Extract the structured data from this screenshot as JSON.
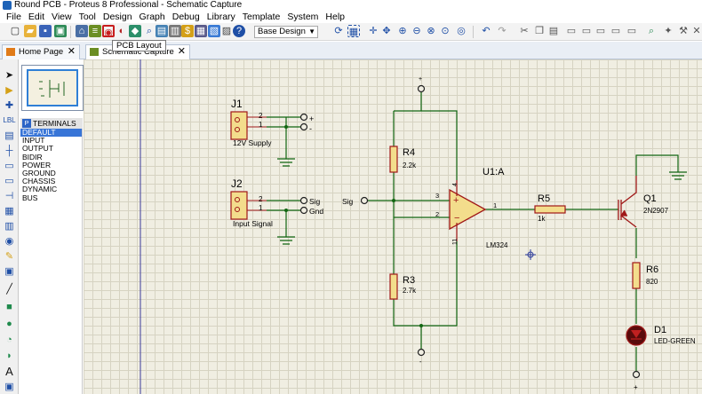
{
  "window": {
    "title": "Round PCB - Proteus 8 Professional - Schematic Capture"
  },
  "menu": [
    "File",
    "Edit",
    "View",
    "Tool",
    "Design",
    "Graph",
    "Debug",
    "Library",
    "Template",
    "System",
    "Help"
  ],
  "toolbar": {
    "design_select": "Base Design",
    "tooltip": "PCB Layout"
  },
  "tabs": [
    {
      "label": "Home Page"
    },
    {
      "label": "Schematic Capture"
    }
  ],
  "terminals": {
    "header": "TERMINALS",
    "button": "P",
    "items": [
      "DEFAULT",
      "INPUT",
      "OUTPUT",
      "BIDIR",
      "POWER",
      "GROUND",
      "CHASSIS",
      "DYNAMIC",
      "BUS"
    ],
    "selected": "DEFAULT"
  },
  "schematic": {
    "j1": {
      "ref": "J1",
      "value": "12V Supply",
      "pin2": "2",
      "pin1": "1",
      "plus": "+",
      "minus": "-"
    },
    "j2": {
      "ref": "J2",
      "value": "Input Signal",
      "pin2": "2",
      "pin1": "1",
      "sig": "Sig",
      "gnd": "Gnd"
    },
    "sig_input": "Sig",
    "r4": {
      "ref": "R4",
      "value": "2.2k"
    },
    "r3": {
      "ref": "R3",
      "value": "2.7k"
    },
    "u1": {
      "ref": "U1:A",
      "value": "LM324",
      "pin3": "3",
      "pin2": "2",
      "pin1": "1",
      "pin4": "4",
      "pin11": "11"
    },
    "r5": {
      "ref": "R5",
      "value": "1k"
    },
    "q1": {
      "ref": "Q1",
      "value": "2N2907"
    },
    "r6": {
      "ref": "R6",
      "value": "820"
    },
    "d1": {
      "ref": "D1",
      "value": "LED-GREEN"
    },
    "top_rail": "+",
    "bottom_rail": "-",
    "led_rail": "+"
  },
  "colors": {
    "wire": "#116611",
    "component": "#a01818",
    "label": "#101010",
    "background": "#f0eee2",
    "grid": "#d6d3c2",
    "selection": "#3875d7"
  }
}
